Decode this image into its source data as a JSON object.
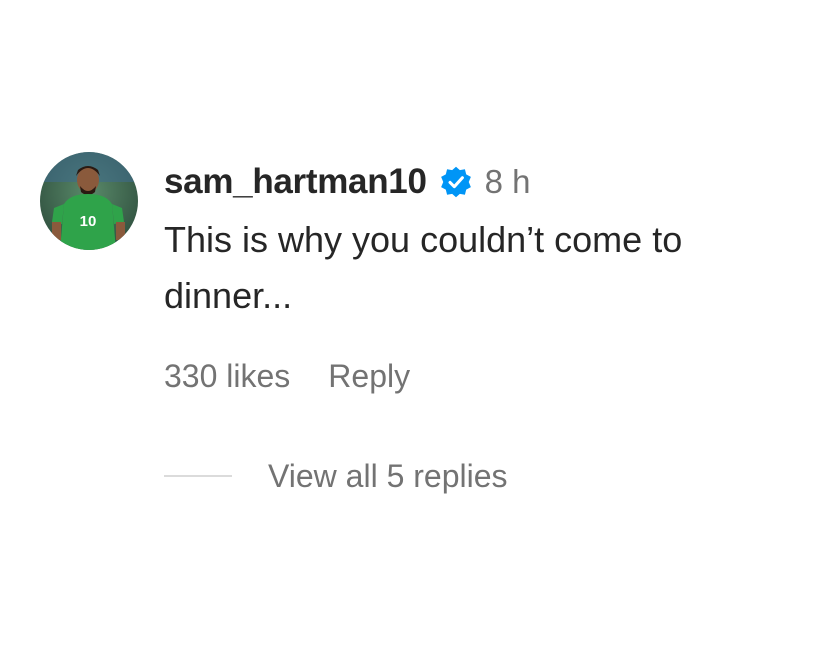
{
  "comment": {
    "username": "sam_hartman10",
    "verified_icon": "verified-badge-icon",
    "timestamp": "8 h",
    "text": "This is why you couldn’t come to dinner...",
    "avatar_icon": "avatar",
    "likes": "330 likes",
    "reply_label": "Reply",
    "view_replies_label": "View all 5 replies"
  },
  "colors": {
    "text": "#262626",
    "secondary": "#737373",
    "verified": "#0095f6",
    "divider": "#dbdbdb",
    "jersey": "#2fa34a"
  }
}
